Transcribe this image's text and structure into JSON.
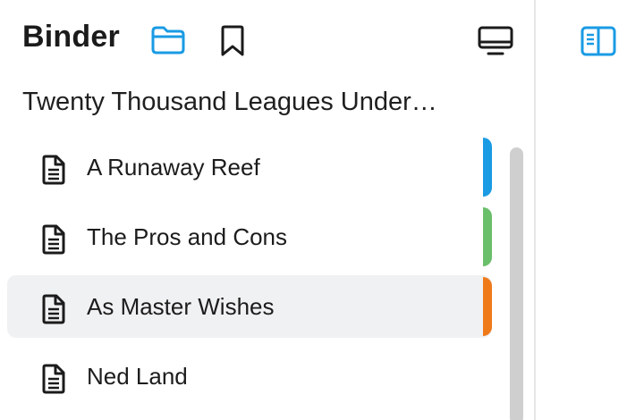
{
  "header": {
    "title": "Binder"
  },
  "icons": {
    "folder": "folder-icon",
    "bookmark": "bookmark-icon",
    "monitor": "monitor-icon",
    "sidebar": "sidebar-toggle-icon",
    "document": "document-icon"
  },
  "colors": {
    "accent_blue": "#1a9be4",
    "label_green": "#6abf6a",
    "label_orange": "#ef7a1a",
    "selected_bg": "#f0f1f3"
  },
  "project": {
    "title": "Twenty Thousand Leagues Under…"
  },
  "chapters": [
    {
      "label": "A Runaway Reef",
      "color": "#1a9be4",
      "selected": false
    },
    {
      "label": "The Pros and Cons",
      "color": "#6abf6a",
      "selected": false
    },
    {
      "label": "As Master Wishes",
      "color": "#ef7a1a",
      "selected": true
    },
    {
      "label": "Ned Land",
      "color": "",
      "selected": false
    }
  ]
}
